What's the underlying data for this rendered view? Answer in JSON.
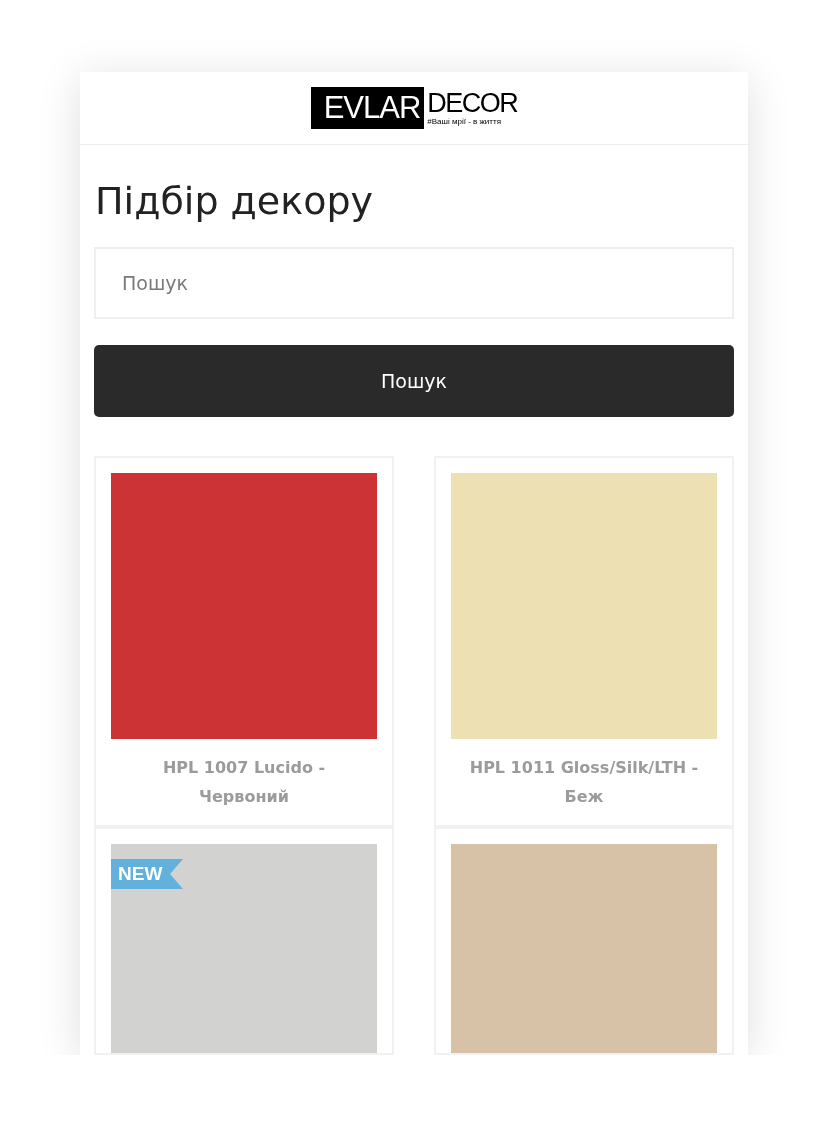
{
  "header": {
    "logo": {
      "mark": "EVLAR",
      "word": "DECOR",
      "tagline": "#Ваші мрії - в життя"
    }
  },
  "page": {
    "title": "Підбір декору"
  },
  "search": {
    "placeholder": "Пошук",
    "button": "Пошук"
  },
  "products": [
    {
      "name": "HPL 1007 Lucido - Червоний",
      "color": "#cb3335"
    },
    {
      "name": "HPL 1011 Gloss/Silk/LTH - Беж",
      "color": "#ede0b2"
    },
    {
      "badge": "NEW",
      "color": "#d2d2d0"
    },
    {
      "color": "#d7c2a8"
    }
  ]
}
